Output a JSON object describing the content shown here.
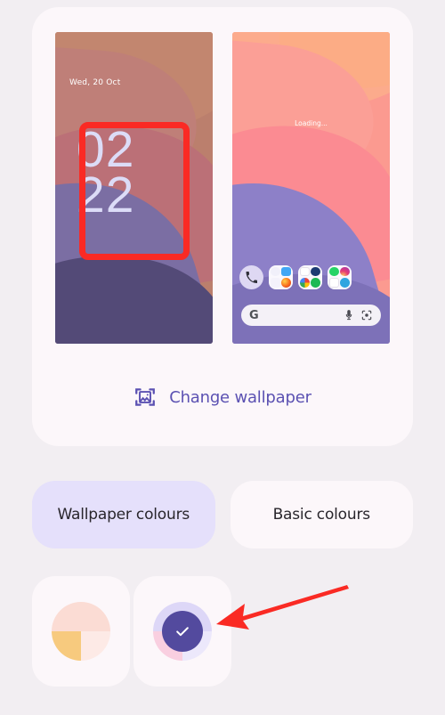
{
  "theme": {
    "page_bg": "#f2eef2",
    "card_bg": "#fcf7fa",
    "accent_purple": "#5b51b2",
    "selected_tab_bg": "#e5e0fb",
    "annotation_red": "#fa2a24"
  },
  "preview": {
    "lock_screen": {
      "date": "Wed, 20 Oct",
      "clock_hours": "02",
      "clock_minutes": "22",
      "wallpaper_colors": [
        "#c2866f",
        "#bf7f78",
        "#bb7077",
        "#7b6ea3",
        "#534a77"
      ]
    },
    "home_screen": {
      "status_text": "Loading...",
      "wallpaper_colors": [
        "#fcab8c",
        "#fb9f96",
        "#fb8b92",
        "#8d80c8",
        "#7d71b8"
      ],
      "dock": {
        "phone_icon": "phone-icon",
        "folders": [
          {
            "name": "folder-1",
            "apps": [
              "app-photos-icon",
              "app-files-icon",
              "app-camera-icon",
              "app-firefox-icon"
            ]
          },
          {
            "name": "folder-2",
            "apps": [
              "app-youtube-icon",
              "app-news-icon",
              "app-chrome-icon",
              "app-spotify-icon"
            ]
          },
          {
            "name": "folder-3",
            "apps": [
              "app-whatsapp-icon",
              "app-instagram-icon",
              "app-mail-icon",
              "app-telegram-icon"
            ]
          }
        ]
      },
      "search_bar": {
        "logo": "google-g-logo",
        "mic_icon": "microphone-icon",
        "lens_icon": "google-lens-icon"
      }
    }
  },
  "change_wallpaper": {
    "icon": "image-crop-icon",
    "label": "Change wallpaper"
  },
  "tabs": [
    {
      "label": "Wallpaper colours",
      "selected": true
    },
    {
      "label": "Basic colours",
      "selected": false
    }
  ],
  "swatches": [
    {
      "name": "swatch-1",
      "selected": false,
      "quadrants": [
        "#fbdcd4",
        "#fbdcd4",
        "#f7ca7e",
        "#fdeae6"
      ]
    },
    {
      "name": "swatch-2",
      "selected": true,
      "quadrants": [
        "#ddd7f7",
        "#ddd7f7",
        "#f9cfe0",
        "#ece8fb"
      ],
      "check_color": "#534a9e",
      "check_glyph": "✓"
    }
  ],
  "annotations": [
    {
      "type": "rectangle",
      "target": "lock-screen-clock",
      "color": "#fa2a24"
    },
    {
      "type": "arrow",
      "target": "swatch-2",
      "direction": "left",
      "color": "#fa2a24"
    }
  ]
}
